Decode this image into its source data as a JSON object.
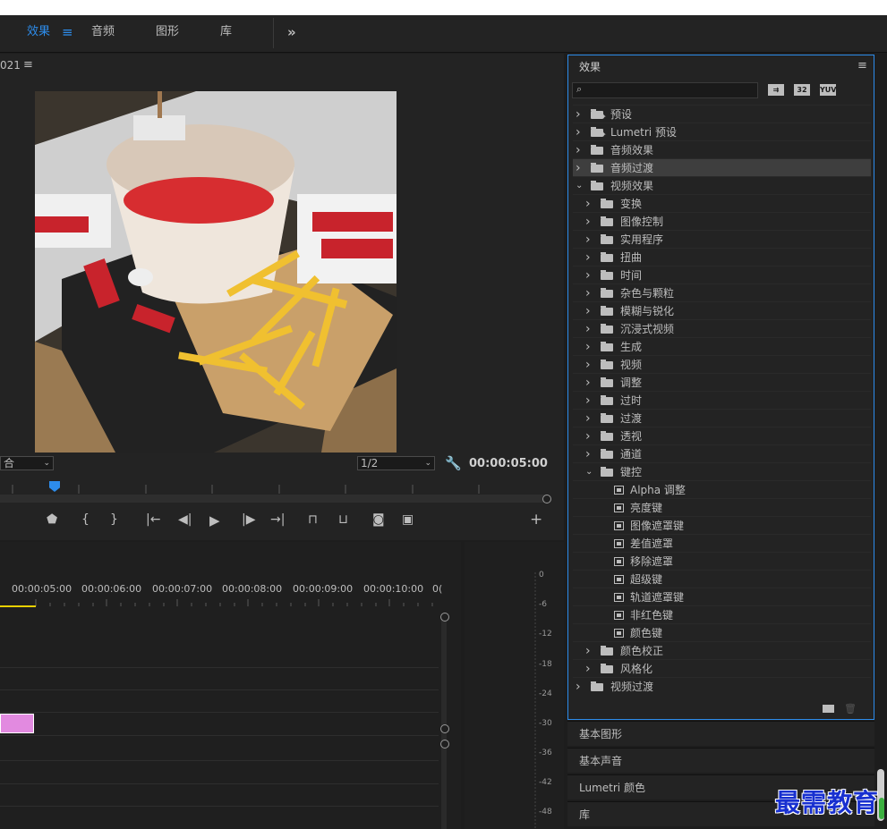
{
  "workspace_tabs": {
    "effects": "效果",
    "effects_menu": "≡",
    "audio": "音频",
    "graphics": "图形",
    "library": "库",
    "more": "»"
  },
  "monitor": {
    "title_fragment": "021",
    "menu": "≡",
    "fit_select": "合",
    "resolution_select": "1/2",
    "timecode": "00:00:05:00"
  },
  "timeline": {
    "time_labels": [
      "00:00:05:00",
      "00:00:06:00",
      "00:00:07:00",
      "00:00:08:00",
      "00:00:09:00",
      "00:00:10:00",
      "0("
    ]
  },
  "audio_meter": {
    "db_labels": [
      "0",
      "-6",
      "-12",
      "-18",
      "-24",
      "-30",
      "-36",
      "-42",
      "-48"
    ]
  },
  "effects_panel": {
    "title": "效果",
    "menu": "≡",
    "search_placeholder": "",
    "filter_buttons": [
      "⇉",
      "32",
      "YUV"
    ],
    "items": [
      {
        "label": "预设",
        "level": 0,
        "icon": "preset-folder-icon",
        "expanded": false
      },
      {
        "label": "Lumetri 预设",
        "level": 0,
        "icon": "preset-folder-icon",
        "expanded": false
      },
      {
        "label": "音频效果",
        "level": 0,
        "icon": "folder-icon",
        "expanded": false
      },
      {
        "label": "音频过渡",
        "level": 0,
        "icon": "folder-icon",
        "expanded": false,
        "selected": true
      },
      {
        "label": "视频效果",
        "level": 0,
        "icon": "folder-icon",
        "expanded": true
      },
      {
        "label": "变换",
        "level": 1,
        "icon": "folder-icon",
        "expanded": false
      },
      {
        "label": "图像控制",
        "level": 1,
        "icon": "folder-icon",
        "expanded": false
      },
      {
        "label": "实用程序",
        "level": 1,
        "icon": "folder-icon",
        "expanded": false
      },
      {
        "label": "扭曲",
        "level": 1,
        "icon": "folder-icon",
        "expanded": false
      },
      {
        "label": "时间",
        "level": 1,
        "icon": "folder-icon",
        "expanded": false
      },
      {
        "label": "杂色与颗粒",
        "level": 1,
        "icon": "folder-icon",
        "expanded": false
      },
      {
        "label": "模糊与锐化",
        "level": 1,
        "icon": "folder-icon",
        "expanded": false
      },
      {
        "label": "沉浸式视频",
        "level": 1,
        "icon": "folder-icon",
        "expanded": false
      },
      {
        "label": "生成",
        "level": 1,
        "icon": "folder-icon",
        "expanded": false
      },
      {
        "label": "视频",
        "level": 1,
        "icon": "folder-icon",
        "expanded": false
      },
      {
        "label": "调整",
        "level": 1,
        "icon": "folder-icon",
        "expanded": false
      },
      {
        "label": "过时",
        "level": 1,
        "icon": "folder-icon",
        "expanded": false
      },
      {
        "label": "过渡",
        "level": 1,
        "icon": "folder-icon",
        "expanded": false
      },
      {
        "label": "透视",
        "level": 1,
        "icon": "folder-icon",
        "expanded": false
      },
      {
        "label": "通道",
        "level": 1,
        "icon": "folder-icon",
        "expanded": false
      },
      {
        "label": "键控",
        "level": 1,
        "icon": "folder-icon",
        "expanded": true
      },
      {
        "label": "Alpha 调整",
        "level": 2,
        "icon": "effect-icon"
      },
      {
        "label": "亮度键",
        "level": 2,
        "icon": "effect-icon"
      },
      {
        "label": "图像遮罩键",
        "level": 2,
        "icon": "effect-icon"
      },
      {
        "label": "差值遮罩",
        "level": 2,
        "icon": "effect-icon"
      },
      {
        "label": "移除遮罩",
        "level": 2,
        "icon": "effect-icon"
      },
      {
        "label": "超级键",
        "level": 2,
        "icon": "effect-icon"
      },
      {
        "label": "轨道遮罩键",
        "level": 2,
        "icon": "effect-icon"
      },
      {
        "label": "非红色键",
        "level": 2,
        "icon": "effect-icon"
      },
      {
        "label": "颜色键",
        "level": 2,
        "icon": "effect-icon"
      },
      {
        "label": "颜色校正",
        "level": 1,
        "icon": "folder-icon",
        "expanded": false
      },
      {
        "label": "风格化",
        "level": 1,
        "icon": "folder-icon",
        "expanded": false
      },
      {
        "label": "视频过渡",
        "level": 0,
        "icon": "folder-icon",
        "expanded": false
      }
    ]
  },
  "collapsed_panels": {
    "essential_graphics": "基本图形",
    "essential_sound": "基本声音",
    "lumetri_color": "Lumetri 颜色",
    "library": "库"
  },
  "watermark": "最需教育",
  "colors": {
    "accent_blue": "#2d8ceb",
    "panel_bg": "#232323",
    "clip_pink": "#e28ae0",
    "playhead_yellow": "#e8d000",
    "watermark_blue": "#1830d0"
  }
}
